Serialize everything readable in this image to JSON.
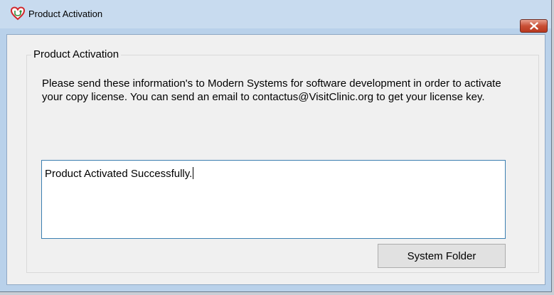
{
  "window": {
    "title": "Product Activation",
    "app_icon": "heart-stethoscope-icon",
    "close_icon": "close-icon",
    "close_color": "#c94f35"
  },
  "group": {
    "title": "Product Activation",
    "message": "Please send these information's to Modern Systems for software development in order to activate your copy license. You can send an email to contactus@VisitClinic.org to get your license key."
  },
  "status": {
    "value": "Product Activated Successfully."
  },
  "buttons": {
    "system_folder": "System Folder"
  }
}
